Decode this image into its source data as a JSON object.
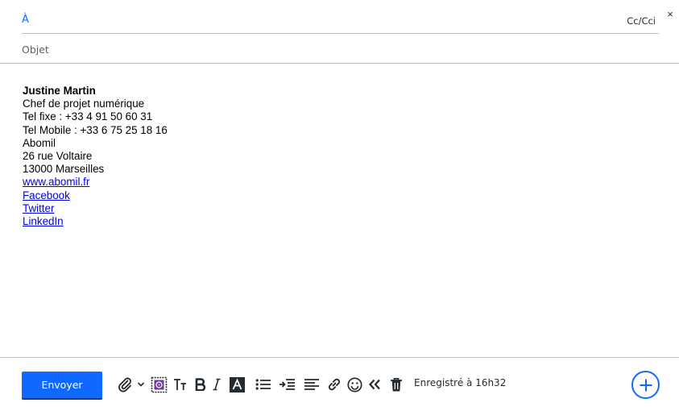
{
  "header": {
    "close_label": "×"
  },
  "to": {
    "label": "À",
    "cc_label": "Cc/Cci"
  },
  "subject": {
    "placeholder": "Objet",
    "value": ""
  },
  "signature": {
    "name": "Justine Martin",
    "lines": [
      "Chef de projet numérique",
      "Tel fixe : +33 4 91 50 60 31",
      "Tel Mobile : +33 6 75 25 18 16",
      "Abomil",
      "26 rue Voltaire",
      "13000 Marseilles"
    ],
    "links": [
      "www.abomil.fr",
      "Facebook",
      "Twitter",
      "LinkedIn"
    ]
  },
  "toolbar": {
    "send_label": "Envoyer",
    "saved_status": "Enregistré à 16h32",
    "icons": [
      "attach-icon",
      "chevron-down-icon",
      "stationery-icon",
      "text-size-icon",
      "bold-icon",
      "italic-icon",
      "text-color-icon",
      "bullet-list-icon",
      "indent-icon",
      "align-icon",
      "link-icon",
      "emoji-icon",
      "double-chevron-left-icon",
      "trash-icon",
      "plus-circle-icon"
    ]
  },
  "colors": {
    "accent": "#0f69ff",
    "text": "#232a31",
    "divider": "#b9bdc5",
    "link": "#0000ee"
  }
}
